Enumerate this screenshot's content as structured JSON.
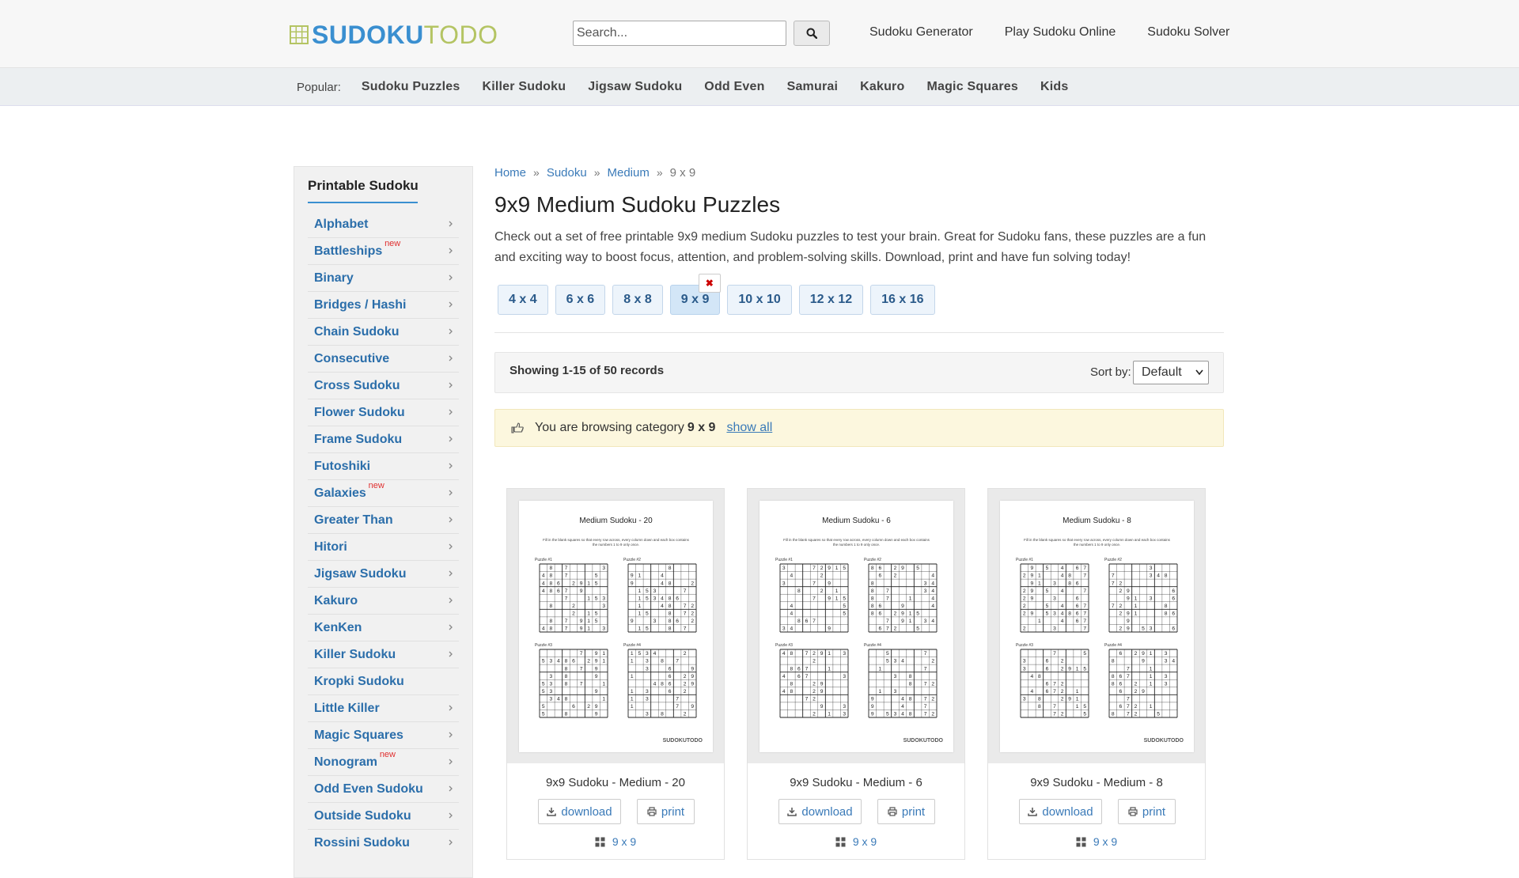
{
  "header": {
    "logo_part1": "SUDOKU",
    "logo_part2": "TODO",
    "search_placeholder": "Search...",
    "nav": [
      "Sudoku Generator",
      "Play Sudoku Online",
      "Sudoku Solver"
    ]
  },
  "popular": {
    "label": "Popular:",
    "links": [
      "Sudoku Puzzles",
      "Killer Sudoku",
      "Jigsaw Sudoku",
      "Odd Even",
      "Samurai",
      "Kakuro",
      "Magic Squares",
      "Kids"
    ]
  },
  "sidebar": {
    "title": "Printable Sudoku",
    "new_label": "new",
    "items": [
      {
        "label": "Alphabet",
        "new": false,
        "chevron": true
      },
      {
        "label": "Battleships",
        "new": true,
        "chevron": true
      },
      {
        "label": "Binary",
        "new": false,
        "chevron": true
      },
      {
        "label": "Bridges / Hashi",
        "new": false,
        "chevron": true
      },
      {
        "label": "Chain Sudoku",
        "new": false,
        "chevron": true
      },
      {
        "label": "Consecutive",
        "new": false,
        "chevron": true
      },
      {
        "label": "Cross Sudoku",
        "new": false,
        "chevron": true
      },
      {
        "label": "Flower Sudoku",
        "new": false,
        "chevron": true
      },
      {
        "label": "Frame Sudoku",
        "new": false,
        "chevron": true
      },
      {
        "label": "Futoshiki",
        "new": false,
        "chevron": true
      },
      {
        "label": "Galaxies",
        "new": true,
        "chevron": true
      },
      {
        "label": "Greater Than",
        "new": false,
        "chevron": true
      },
      {
        "label": "Hitori",
        "new": false,
        "chevron": true
      },
      {
        "label": "Jigsaw Sudoku",
        "new": false,
        "chevron": true
      },
      {
        "label": "Kakuro",
        "new": false,
        "chevron": true
      },
      {
        "label": "KenKen",
        "new": false,
        "chevron": true
      },
      {
        "label": "Killer Sudoku",
        "new": false,
        "chevron": true
      },
      {
        "label": "Kropki Sudoku",
        "new": false,
        "chevron": false
      },
      {
        "label": "Little Killer",
        "new": false,
        "chevron": true
      },
      {
        "label": "Magic Squares",
        "new": false,
        "chevron": true
      },
      {
        "label": "Nonogram",
        "new": true,
        "chevron": true
      },
      {
        "label": "Odd Even Sudoku",
        "new": false,
        "chevron": true
      },
      {
        "label": "Outside Sudoku",
        "new": false,
        "chevron": true
      },
      {
        "label": "Rossini Sudoku",
        "new": false,
        "chevron": true
      }
    ]
  },
  "breadcrumb": [
    {
      "label": "Home",
      "link": true
    },
    {
      "label": "Sudoku",
      "link": true
    },
    {
      "label": "Medium",
      "link": true
    },
    {
      "label": "9 x 9",
      "link": false
    }
  ],
  "breadcrumb_sep": "»",
  "page": {
    "title": "9x9 Medium Sudoku Puzzles",
    "description": "Check out a set of free printable 9x9 medium Sudoku puzzles to test your brain. Great for Sudoku fans, these puzzles are a fun and exciting way to boost focus, attention, and problem-solving skills. Download, print and have fun solving today!"
  },
  "size_tabs": [
    {
      "label": "4 x 4",
      "active": false
    },
    {
      "label": "6 x 6",
      "active": false
    },
    {
      "label": "8 x 8",
      "active": false
    },
    {
      "label": "9 x 9",
      "active": true
    },
    {
      "label": "10 x 10",
      "active": false
    },
    {
      "label": "12 x 12",
      "active": false
    },
    {
      "label": "16 x 16",
      "active": false
    }
  ],
  "records": {
    "text": "Showing 1-15 of 50 records",
    "sort_label": "Sort by:",
    "sort_value": "Default"
  },
  "browse": {
    "text": "You are browsing category",
    "category": "9 x 9",
    "show_all": "show all"
  },
  "cards": [
    {
      "sheet_title": "Medium Sudoku - 20",
      "title": "9x9 Sudoku - Medium - 20",
      "download": "download",
      "print": "print",
      "category": "9 x 9"
    },
    {
      "sheet_title": "Medium Sudoku - 6",
      "title": "9x9 Sudoku - Medium - 6",
      "download": "download",
      "print": "print",
      "category": "9 x 9"
    },
    {
      "sheet_title": "Medium Sudoku - 8",
      "title": "9x9 Sudoku - Medium - 8",
      "download": "download",
      "print": "print",
      "category": "9 x 9"
    }
  ],
  "sheet": {
    "instructions": "Fill in the blank squares so that every row across, every column down and each box contains the numbers 1 to 9 only once.",
    "puzzle_labels": [
      "Puzzle #1",
      "Puzzle #2",
      "Puzzle #3",
      "Puzzle #4"
    ],
    "brand": "SUDOKUTODO"
  },
  "colors": {
    "accent": "#3a8fd0",
    "logo_green": "#b4c463",
    "link": "#3a7ab8",
    "new_badge": "#e03030"
  },
  "icons": [
    "search-icon",
    "chevron-right-icon",
    "close-icon",
    "hand-point-icon",
    "download-icon",
    "print-icon",
    "grid-icon",
    "caret-down-icon"
  ]
}
